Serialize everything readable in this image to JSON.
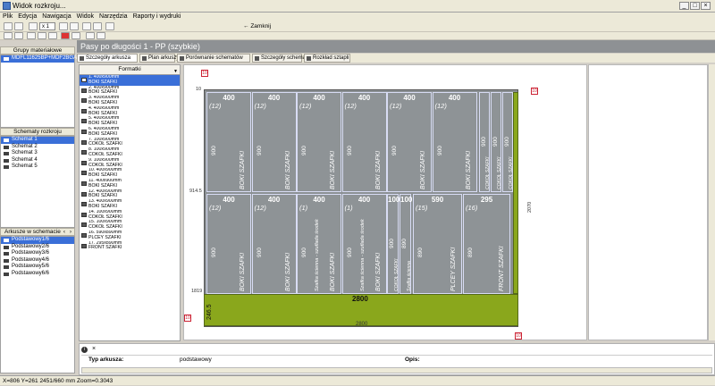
{
  "window": {
    "title": "Widok rozkroju..."
  },
  "menu": [
    "Plik",
    "Edycja",
    "Nawigacja",
    "Widok",
    "Narzędzia",
    "Raporty i wydruki"
  ],
  "toolbar": {
    "zoom": "x 1",
    "close_label": "Zamknij"
  },
  "left": {
    "material_groups_head": "Grupy materiałowe",
    "material_item": "MDFL11625BP+MDF2BGA",
    "schemes_head": "Schematy rozkroju",
    "schemes": [
      "Schemat 1",
      "Schemat 2",
      "Schemat 3",
      "Schemat 4",
      "Schemat 5"
    ],
    "sheets_head": "Arkusze w schemacie",
    "sheets": [
      "Podstawowy1/6",
      "Podstawowy2/6",
      "Podstawowy3/6",
      "Podstawowy4/6",
      "Podstawowy5/6",
      "Podstawowy6/6"
    ]
  },
  "main_title": "Pasy po długości 1 - PP (szybkie)",
  "tabs": [
    "Szczegóły arkusza",
    "Plan arkuszy",
    "Porównanie schematów",
    "Szczegóły schematu",
    "Rozkład sztapli"
  ],
  "formatki": {
    "head": "Formatki",
    "items": [
      [
        "1.  400x900mm",
        "BOKI SZAFKI"
      ],
      [
        "2.  400x900mm",
        "BOKI SZAFKI"
      ],
      [
        "3.  400x900mm",
        "BOKI SZAFKI"
      ],
      [
        "4.  400x900mm",
        "BOKI SZAFKI"
      ],
      [
        "5.  400x900mm",
        "BOKI SZAFKI"
      ],
      [
        "6.  400x900mm",
        "BOKI SZAFKI"
      ],
      [
        "7.  100x900mm",
        "COKOŁ SZAFKI"
      ],
      [
        "8.  100x900mm",
        "COKOŁ SZAFKI"
      ],
      [
        "9.  100x900mm",
        "COKOŁ SZAFKI"
      ],
      [
        "10. 400x900mm",
        "BOKI SZAFKI"
      ],
      [
        "11. 400x900mm",
        "BOKI SZAFKI"
      ],
      [
        "12. 400x900mm",
        "BOKI SZAFKI"
      ],
      [
        "13. 400x900mm",
        "BOKI SZAFKI"
      ],
      [
        "14. 100x900mm",
        "COKOŁ SZAFKI"
      ],
      [
        "15. 100x900mm",
        "COKOŁ SZAFKI"
      ],
      [
        "16. 590x890mm",
        "PLCEY SZAFKI"
      ],
      [
        "17. 295x890mm",
        "FRONT SZAFKI"
      ]
    ]
  },
  "sheet": {
    "width_label": "2800",
    "bottom_label": "2800",
    "right_label": "2070",
    "left_strip": "246.5",
    "ruler_top": "10",
    "ruler_mid": "914.5",
    "ruler_bottom": "1819",
    "marks": [
      "10",
      "10",
      "10",
      "10"
    ],
    "row1": [
      {
        "dim": "400",
        "qty": "(12)",
        "h": "900",
        "name": "BOKI SZAFKI"
      },
      {
        "dim": "400",
        "qty": "(12)",
        "h": "900",
        "name": "BOKI SZAFKI"
      },
      {
        "dim": "400",
        "qty": "(12)",
        "h": "900",
        "name": "BOKI SZAFKI"
      },
      {
        "dim": "400",
        "qty": "(12)",
        "h": "900",
        "name": "BOKI SZAFKI"
      },
      {
        "dim": "400",
        "qty": "(12)",
        "h": "900",
        "name": "BOKI SZAFKI"
      },
      {
        "dim": "400",
        "qty": "(12)",
        "h": "900",
        "name": "BOKI SZAFKI"
      }
    ],
    "row1_small": [
      {
        "h": "900",
        "name": "COKOŁ SZAFKI"
      },
      {
        "h": "900",
        "name": "COKOŁ SZAFKI"
      },
      {
        "h": "900",
        "name": "COKOŁ SZAFKI"
      }
    ],
    "row2": [
      {
        "dim": "400",
        "qty": "(12)",
        "h": "900",
        "name": "BOKI SZAFKI"
      },
      {
        "dim": "400",
        "qty": "(12)",
        "h": "900",
        "name": "BOKI SZAFKI"
      },
      {
        "dim": "400",
        "qty": "(1)",
        "h": "900",
        "name": "BOKI SZAFKI",
        "extra": "Szafka ścienna - szuflada środek"
      },
      {
        "dim": "400",
        "qty": "(1)",
        "h": "900",
        "name": "BOKI SZAFKI",
        "extra": "Szafka ścienna - szuflada środek"
      },
      {
        "dim": "590",
        "qty": "(15)",
        "h": "890",
        "name": "PLCEY SZAFKI"
      },
      {
        "dim": "295",
        "qty": "(16)",
        "h": "890",
        "name": "FRONT SZAFKI"
      }
    ],
    "row2_small": [
      {
        "dim": "100",
        "h": "900",
        "name": "COKOŁ SZAFKI"
      },
      {
        "dim": "100",
        "h": "890",
        "name": "Szafka ścienna"
      }
    ],
    "waste_label": "2800"
  },
  "props": {
    "info": "i",
    "close": "×",
    "type_label": "Typ arkusza:",
    "type_value": "podstawowy",
    "desc_label": "Opis:"
  },
  "status": "X=806 Y=261   2451/660 mm  Zoom=0.3043"
}
